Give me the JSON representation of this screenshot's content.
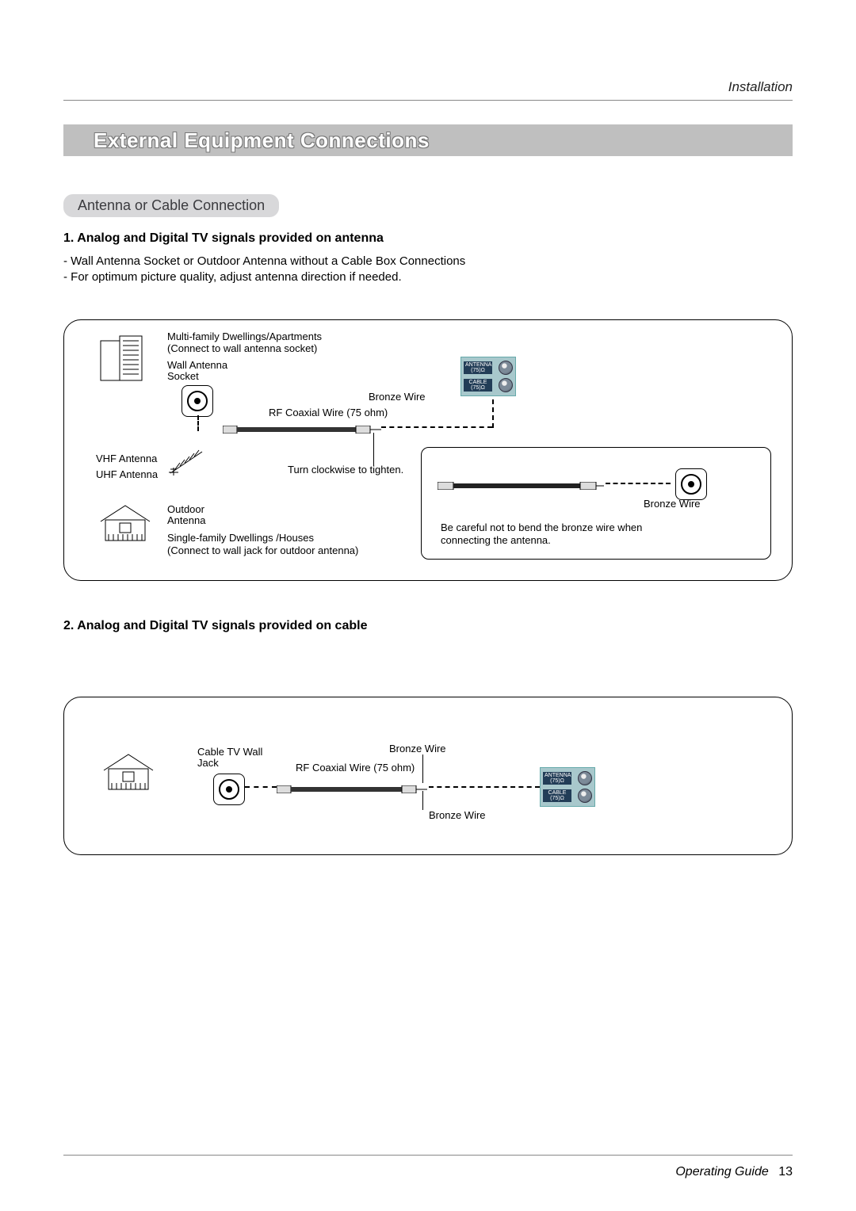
{
  "header": {
    "section": "Installation"
  },
  "title": "External Equipment Connections",
  "subhead": "Antenna or Cable Connection",
  "sec1": {
    "heading": "1. Analog and Digital TV signals provided on antenna",
    "bullets": [
      "Wall Antenna Socket or Outdoor Antenna without a Cable Box Connections",
      "For optimum picture quality, adjust antenna direction if needed."
    ]
  },
  "dia1": {
    "multi_dwelling": "Multi-family Dwellings/Apartments",
    "multi_sub": "(Connect to wall antenna socket)",
    "wall_socket": "Wall Antenna\nSocket",
    "bronze_wire": "Bronze Wire",
    "rf_wire": "RF Coaxial Wire (75 ohm)",
    "turn_tighten": "Turn clockwise to tighten.",
    "vhf": "VHF Antenna",
    "uhf": "UHF Antenna",
    "outdoor_antenna": "Outdoor\nAntenna",
    "single_dwelling": "Single-family Dwellings /Houses",
    "single_sub": "(Connect to wall jack for outdoor antenna)",
    "caution_l1": "Be careful not to bend the bronze wire when",
    "caution_l2": "connecting the antenna.",
    "panel_antenna": "ANTENNA\n(75)Ω",
    "panel_cable": "CABLE\n(75)Ω"
  },
  "sec2": {
    "heading": "2. Analog and Digital TV signals provided on cable"
  },
  "dia2": {
    "cable_jack": "Cable TV Wall\nJack",
    "rf_wire": "RF Coaxial Wire (75 ohm)",
    "bronze_wire_top": "Bronze Wire",
    "bronze_wire_bot": "Bronze Wire",
    "panel_antenna": "ANTENNA\n(75)Ω",
    "panel_cable": "CABLE\n(75)Ω"
  },
  "footer": {
    "guide": "Operating Guide",
    "page": "13"
  }
}
